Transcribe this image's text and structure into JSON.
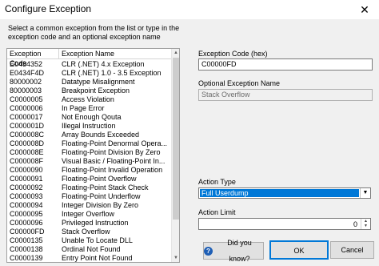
{
  "window": {
    "title": "Configure Exception",
    "close_glyph": "✕"
  },
  "instructions": "Select a common exception from the list or type in the exception code and an optional exception name",
  "list": {
    "columns": [
      "Exception Code",
      "Exception Name"
    ],
    "rows": [
      {
        "code": "E0434352",
        "name": "CLR (.NET) 4.x Exception"
      },
      {
        "code": "E0434F4D",
        "name": "CLR (.NET) 1.0 - 3.5 Exception"
      },
      {
        "code": "80000002",
        "name": "Datatype Misalignment"
      },
      {
        "code": "80000003",
        "name": "Breakpoint Exception"
      },
      {
        "code": "C0000005",
        "name": "Access Violation"
      },
      {
        "code": "C0000006",
        "name": "In Page Error"
      },
      {
        "code": "C0000017",
        "name": "Not Enough Qouta"
      },
      {
        "code": "C000001D",
        "name": "Illegal Instruction"
      },
      {
        "code": "C000008C",
        "name": "Array Bounds Exceeded"
      },
      {
        "code": "C000008D",
        "name": "Floating-Point Denormal Opera..."
      },
      {
        "code": "C000008E",
        "name": "Floating-Point Division By Zero"
      },
      {
        "code": "C000008F",
        "name": "Visual Basic / Floating-Point In..."
      },
      {
        "code": "C0000090",
        "name": "Floating-Point Invalid Operation"
      },
      {
        "code": "C0000091",
        "name": "Floating-Point Overflow"
      },
      {
        "code": "C0000092",
        "name": "Floating-Point Stack Check"
      },
      {
        "code": "C0000093",
        "name": "Floating-Point Underflow"
      },
      {
        "code": "C0000094",
        "name": "Integer Division By Zero"
      },
      {
        "code": "C0000095",
        "name": "Integer Overflow"
      },
      {
        "code": "C0000096",
        "name": "Privileged Instruction"
      },
      {
        "code": "C00000FD",
        "name": "Stack Overflow"
      },
      {
        "code": "C0000135",
        "name": "Unable To Locate DLL"
      },
      {
        "code": "C0000138",
        "name": "Ordinal Not Found"
      },
      {
        "code": "C0000139",
        "name": "Entry Point Not Found"
      }
    ]
  },
  "exception_code": {
    "label": "Exception Code (hex)",
    "value": "C00000FD"
  },
  "exception_name": {
    "label": "Optional Exception Name",
    "value": "Stack Overflow"
  },
  "action_type": {
    "label": "Action Type",
    "selected": "Full Userdump"
  },
  "action_limit": {
    "label": "Action Limit",
    "value": "0"
  },
  "buttons": {
    "did_you_know": "Did you know?",
    "ok": "OK",
    "cancel": "Cancel",
    "help_glyph": "?"
  },
  "colors": {
    "selection": "#0078d7",
    "dialog_bg": "#f0f0f0"
  },
  "icons": {
    "close": "close-icon",
    "help": "question-icon",
    "dropdown": "chevron-down-icon"
  }
}
